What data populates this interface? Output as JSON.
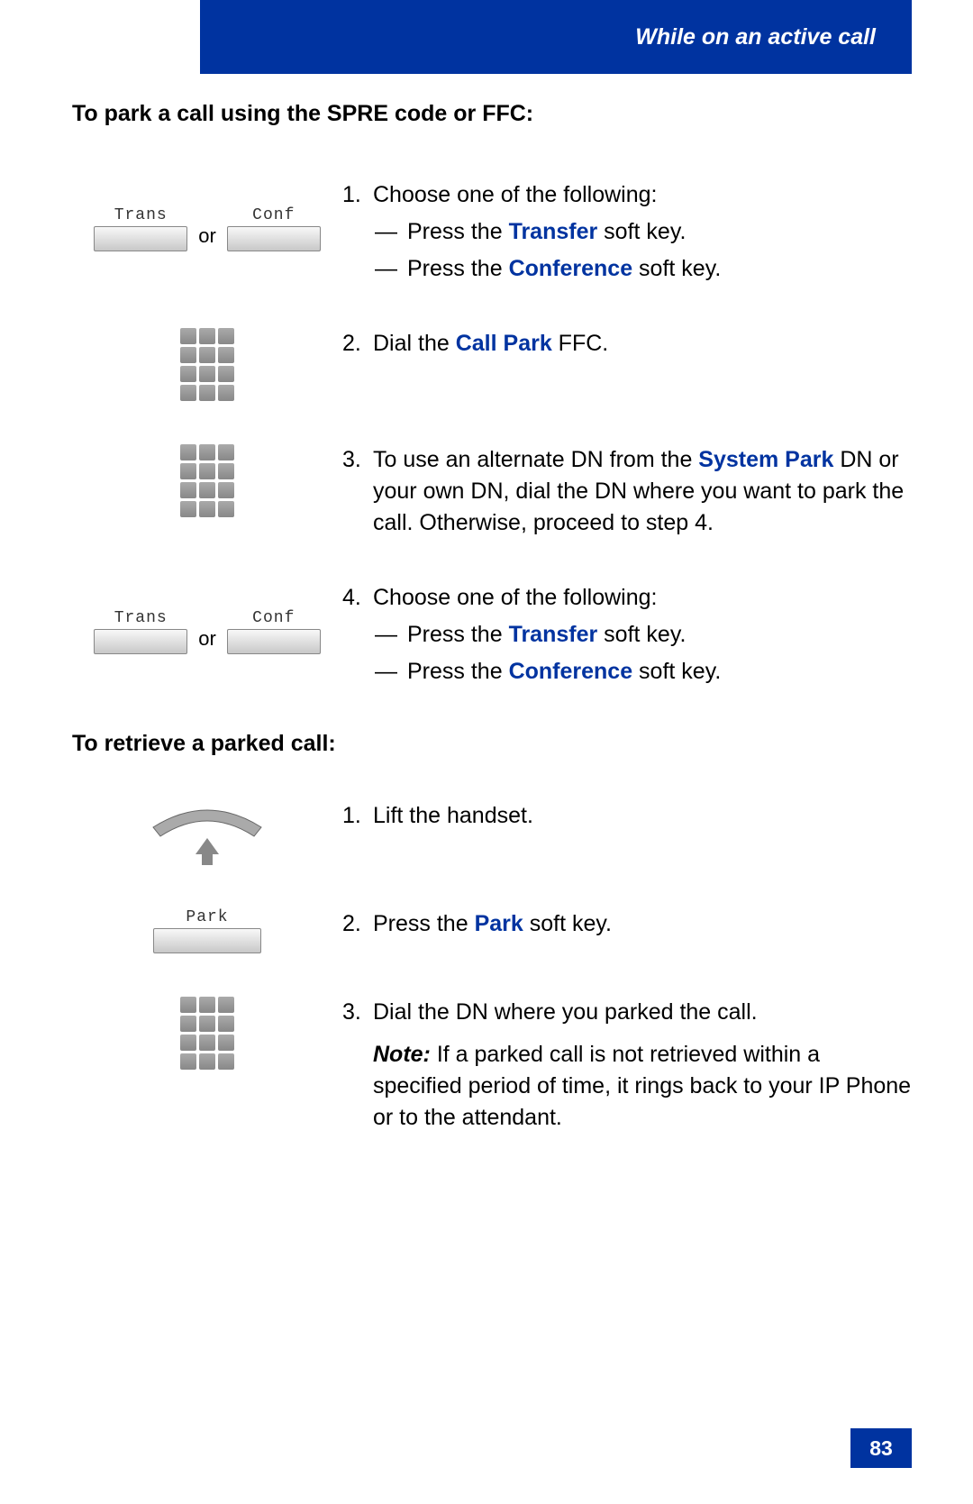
{
  "header": {
    "title": "While on an active call"
  },
  "page_number": "83",
  "softkeys": {
    "trans": "Trans",
    "conf": "Conf",
    "park": "Park",
    "or": "or"
  },
  "section1": {
    "heading": "To park a call using the SPRE code or FFC:",
    "step1": {
      "num": "1.",
      "lead": "Choose one of the following:",
      "a_pre": "Press the ",
      "a_term": "Transfer",
      "a_post": " soft key.",
      "b_pre": "Press the ",
      "b_term": "Conference",
      "b_post": " soft key.",
      "dash": "—"
    },
    "step2": {
      "num": "2.",
      "pre": "Dial the ",
      "term": "Call Park",
      "post": " FFC."
    },
    "step3": {
      "num": "3.",
      "pre": "To use an alternate DN from the ",
      "term": "System Park",
      "post": " DN or your own DN, dial the DN where you want to park the call. Otherwise, proceed to step 4."
    },
    "step4": {
      "num": "4.",
      "lead": "Choose one of the following:",
      "a_pre": "Press the ",
      "a_term": "Transfer",
      "a_post": " soft key.",
      "b_pre": "Press the ",
      "b_term": "Conference",
      "b_post": " soft key.",
      "dash": "—"
    }
  },
  "section2": {
    "heading": "To retrieve a parked call:",
    "step1": {
      "num": "1.",
      "text": "Lift the handset."
    },
    "step2": {
      "num": "2.",
      "pre": "Press the ",
      "term": "Park",
      "post": " soft key."
    },
    "step3": {
      "num": "3.",
      "text": "Dial the DN where you parked the call.",
      "note_label": "Note:",
      "note_text": " If a parked call is not retrieved within a specified period of time, it rings back to your IP Phone or to the attendant."
    }
  }
}
